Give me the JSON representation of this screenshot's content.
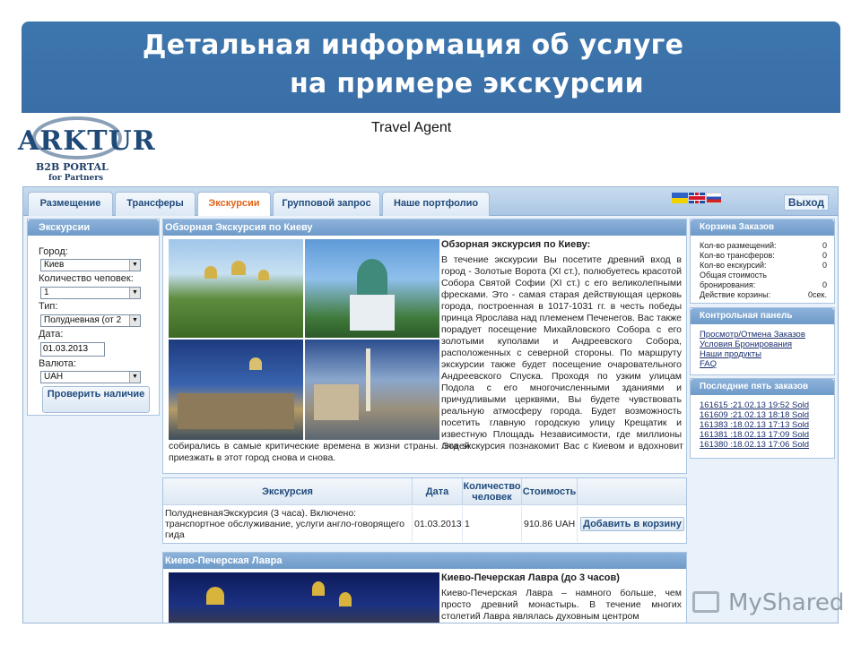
{
  "slide": {
    "title_line1": "Детальная информация об услуге",
    "title_line2": "на примере экскурсии",
    "travel_agent": "Travel Agent"
  },
  "logo": {
    "name": "ARKTUR",
    "sub1": "B2B PORTAL",
    "sub2": "for Partners"
  },
  "tabs": [
    {
      "label": "Размещение"
    },
    {
      "label": "Трансферы"
    },
    {
      "label": "Экскурсии"
    },
    {
      "label": "Групповой запрос"
    },
    {
      "label": "Наше портфолио"
    }
  ],
  "active_tab": "Экскурсии",
  "logout_label": "Выход",
  "left_panel": {
    "title": "Экскурсии",
    "city_label": "Город:",
    "city_value": "Киев",
    "persons_label": "Количество чеповек:",
    "persons_value": "1",
    "type_label": "Тип:",
    "type_value": "Полудневная (от 2",
    "date_label": "Дата:",
    "date_value": "01.03.2013",
    "currency_label": "Валюта:",
    "currency_value": "UAH",
    "check_button": "Проверить наличие"
  },
  "tour": {
    "section_title": "Обзорная Экскурсия по Киеву",
    "heading": "Обзорная экскурсия по Киеву:",
    "text": "В течение экскурсии Вы посетите древний вход в город - Золотые Ворота (XI ст.), полюбуетесь красотой Собора Святой Софии (XI ст.) с его великолепными фресками. Это - самая старая действующая церковь города, построенная в 1017-1031 гг. в честь победы принца Ярослава над племенем Печенегов. Вас также порадует посещение Михайловского Собора с его золотыми куполами и Андреевского Собора, расположенных с северной стороны. По маршруту экскурсии также будет посещение очаровательного Андреевского Спуска. Проходя по узким улицам Подола с его многочисленными зданиями и причудливыми церквями, Вы будете чувствовать реальную атмосферу города. Будет возможность посетить главную городскую улицу Крещатик и известную Площадь Независимости, где миллионы людей",
    "text_cont": "собирались в самые критические времена в жизни страны. Эта экскурсия познакомит Вас с Киевом и вдохновит приезжать в этот город снова и снова."
  },
  "booking_table": {
    "headers": [
      "Экскурсия",
      "Дата",
      "Количество человек",
      "Стоимость"
    ],
    "row": {
      "tour": "ПолудневнаяЭкскурсия (3 часа). Включено: транспортное обслуживание, услуги англо-говорящего гида",
      "date": "01.03.2013",
      "persons": "1",
      "price": "910.86 UAH"
    },
    "add_button": "Добавить в корзину"
  },
  "lavra": {
    "section_title": "Киево-Печерская Лавра",
    "heading": "Киево-Печерская Лавра (до 3 часов)",
    "text": "Киево-Печерская Лавра – намного больше, чем просто древний монастырь. В течение многих столетий Лавра являлась духовным центром"
  },
  "cart": {
    "title": "Корзина Заказов",
    "rows": [
      {
        "label": "Кол-во размещений:",
        "value": "0"
      },
      {
        "label": "Кол-во трансферов:",
        "value": "0"
      },
      {
        "label": "Кол-во екскурсий:",
        "value": "0"
      },
      {
        "label": "Общая стоимость",
        "value": ""
      },
      {
        "label": "бронирования:",
        "value": "0"
      },
      {
        "label": "Действие корзины:",
        "value": "0сек."
      }
    ]
  },
  "control_panel": {
    "title": "Контрольная панель",
    "links": [
      "Просмотр/Отмена Заказов",
      "Условия Бронирования",
      "Наши продукты",
      "FAQ"
    ]
  },
  "orders": {
    "title": "Последние пять заказов",
    "links": [
      "161615 :21.02.13 19:52 Sold",
      "161609 :21.02.13 18:18 Sold",
      "161383 :18.02.13 17:13 Sold",
      "161381 :18.02.13 17:09 Sold",
      "161380 :18.02.13 17:06 Sold"
    ]
  },
  "watermark": "MyShared",
  "colors": {
    "header_blue": "#3a6ea6",
    "active_tab": "#e0651b",
    "panel_head": "#7aa3cf"
  }
}
